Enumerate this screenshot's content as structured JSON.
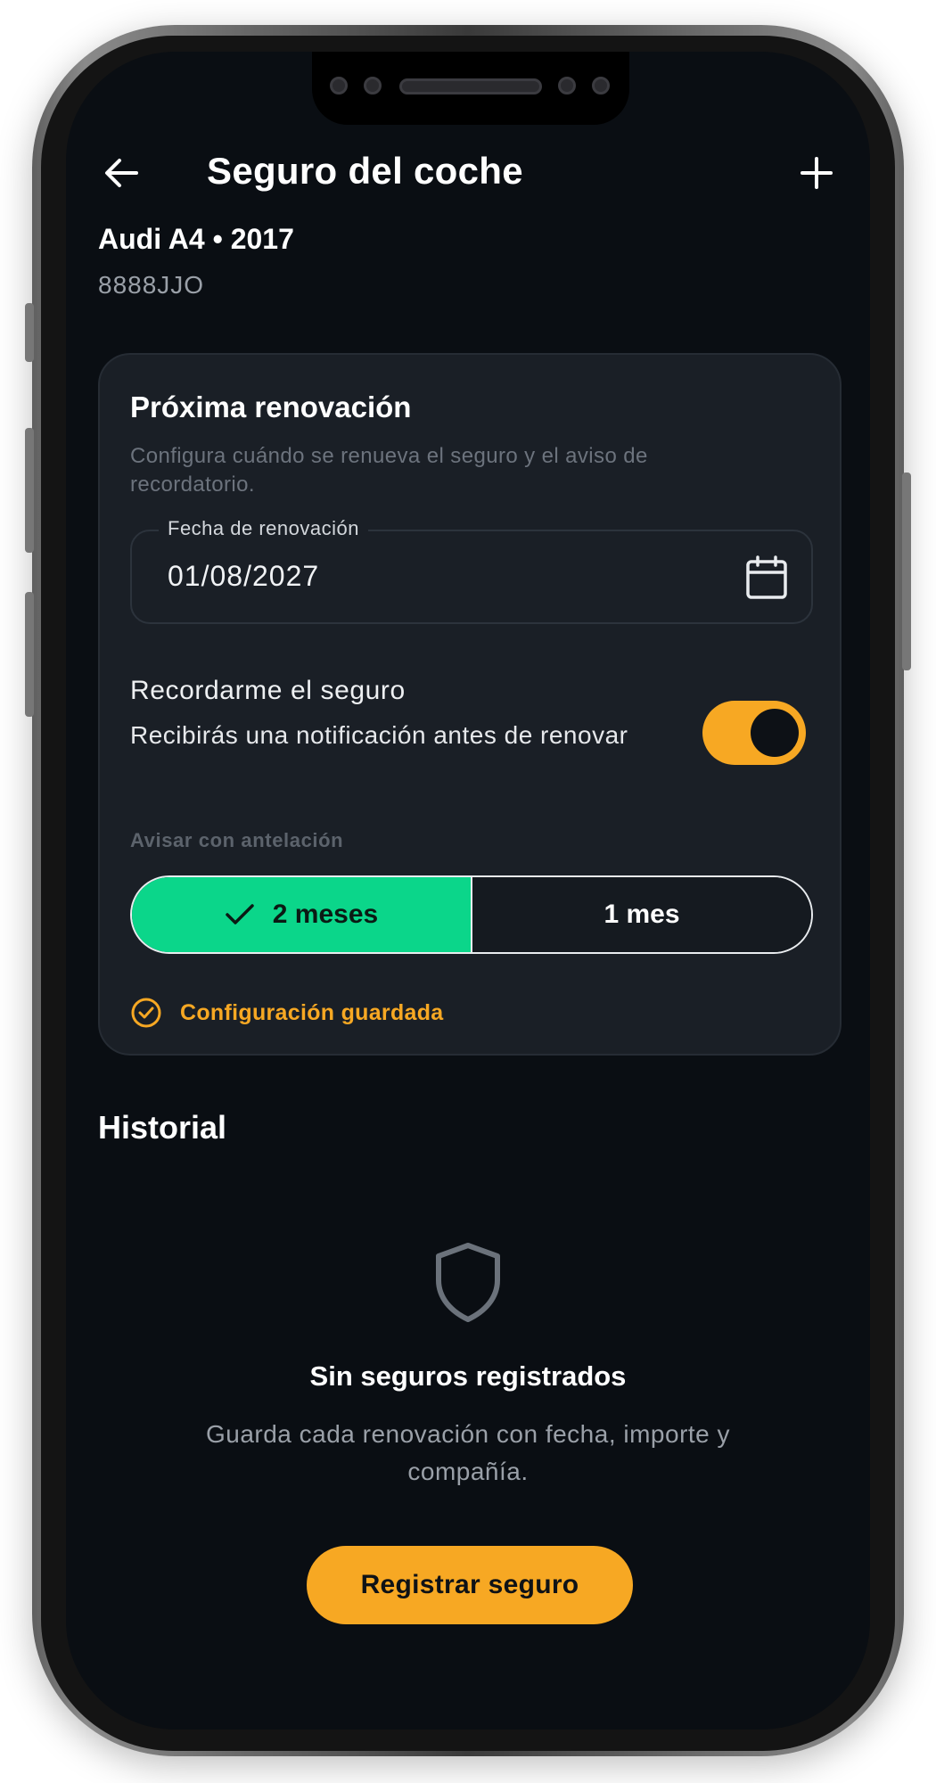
{
  "header": {
    "title": "Seguro del coche",
    "back_icon": "arrow-left-icon",
    "add_icon": "plus-icon"
  },
  "vehicle": {
    "name": "Audi A4 • 2017",
    "plate": "8888JJO"
  },
  "renewal_card": {
    "title": "Próxima renovación",
    "description": "Configura cuándo se renueva el seguro y el aviso de recordatorio.",
    "date_field": {
      "label": "Fecha de renovación",
      "value": "01/08/2027",
      "icon": "calendar-icon"
    },
    "reminder": {
      "title": "Recordarme el seguro",
      "subtitle": "Recibirás una notificación antes de renovar",
      "enabled": true
    },
    "advance": {
      "label": "Avisar con antelación",
      "options": [
        "2 meses",
        "1 mes"
      ],
      "selected": "2 meses"
    },
    "status": {
      "text": "Configuración guardada",
      "icon": "check-circle-icon"
    }
  },
  "history": {
    "title": "Historial",
    "empty_icon": "shield-icon",
    "empty_title": "Sin seguros registrados",
    "empty_description": "Guarda cada renovación con fecha, importe y compañía.",
    "cta_label": "Registrar seguro"
  },
  "colors": {
    "background": "#0a0e13",
    "card": "#1a1f26",
    "accent": "#f7a823",
    "success": "#0bd68a",
    "muted_text": "#9aa0a8"
  }
}
